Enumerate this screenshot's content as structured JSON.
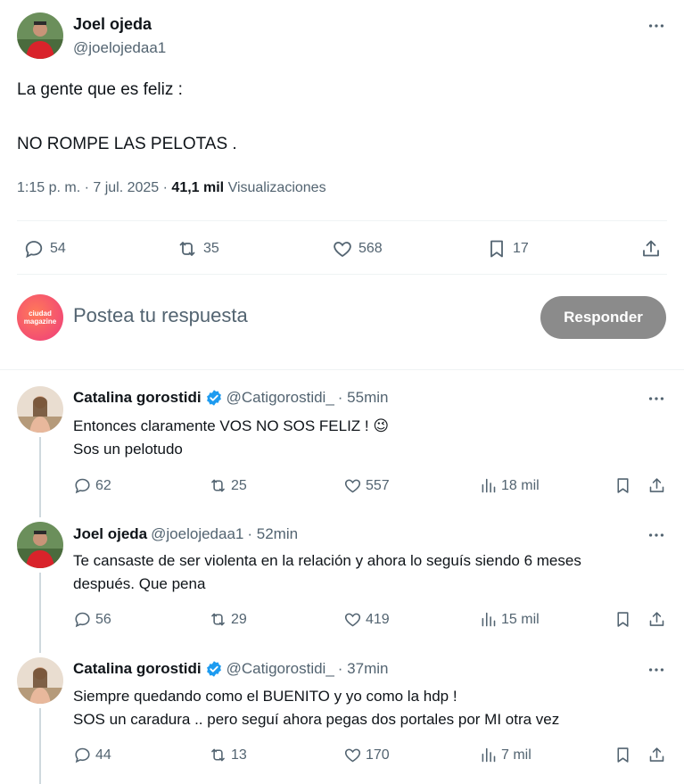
{
  "main_tweet": {
    "author_name": "Joel ojeda",
    "author_handle": "@joelojedaa1",
    "line1": "La gente que es feliz :",
    "line2": "NO ROMPE LAS PELOTAS .",
    "time": "1:15 p. m. · 7 jul. 2025 · ",
    "views_count": "41,1 mil",
    "views_label": " Visualizaciones",
    "replies": "54",
    "retweets": "35",
    "likes": "568",
    "bookmarks": "17"
  },
  "compose": {
    "avatar_text_1": "ciudad",
    "avatar_text_2": "magazine",
    "placeholder": "Postea tu respuesta",
    "button": "Responder"
  },
  "replies": [
    {
      "name": "Catalina gorostidi",
      "handle": "@Catigorostidi_",
      "time": "· 55min",
      "line1": "Entonces claramente VOS NO SOS FELIZ ! 😉",
      "line2": "Sos un pelotudo",
      "replies": "62",
      "retweets": "25",
      "likes": "557",
      "views": "18 mil"
    },
    {
      "name": "Joel ojeda",
      "handle": "@joelojedaa1",
      "time": "· 52min",
      "line1": "Te cansaste de ser violenta en la relación y ahora lo seguís siendo 6 meses",
      "line2": "después. Que pena",
      "replies": "56",
      "retweets": "29",
      "likes": "419",
      "views": "15 mil"
    },
    {
      "name": "Catalina gorostidi",
      "handle": "@Catigorostidi_",
      "time": "· 37min",
      "line1": "Siempre quedando como el BUENITO y yo como la hdp !",
      "line2": "SOS un caradura .. pero seguí ahora pegas dos portales por MI otra vez",
      "replies": "44",
      "retweets": "13",
      "likes": "170",
      "views": "7 mil"
    }
  ],
  "colors": {
    "verified": "#1d9bf0",
    "button": "#8b8b8b",
    "secondary_text": "#536471"
  }
}
